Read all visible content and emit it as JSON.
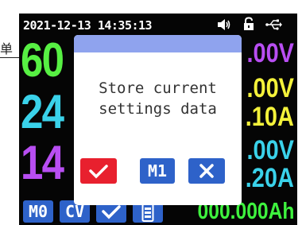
{
  "status": {
    "datetime": "2021-12-13 14:35:13",
    "icons": [
      "speaker-icon",
      "lock-icon",
      "usb-icon"
    ]
  },
  "readings": {
    "set_voltage": "60",
    "set_current": "24",
    "set_power": "14",
    "output_voltage_partial": ".00V",
    "output_voltage2_partial": ".00V",
    "output_current_partial": ".10A",
    "output_voltage3_partial": ".00V",
    "output_current2_partial": ".20A"
  },
  "bottom": {
    "memory": "M0",
    "mode": "CV",
    "capacity": "000.000Ah",
    "icons": [
      "check-icon",
      "battery-icon"
    ]
  },
  "dialog": {
    "message_line1": "Store current",
    "message_line2": "settings data",
    "m1_label": "M1",
    "icons": [
      "confirm-check-icon",
      "cancel-x-icon"
    ]
  },
  "background_char": "单",
  "colors": {
    "voltage": "#57f043",
    "current": "#3ad2ea",
    "power": "#b84ef2",
    "output": "#f4f23a",
    "capacity": "#3ef23e",
    "tag": "#2e62c9",
    "confirm": "#e8202e",
    "cancel": "#2e62c9",
    "dialog_header": "#8fa3ee"
  }
}
